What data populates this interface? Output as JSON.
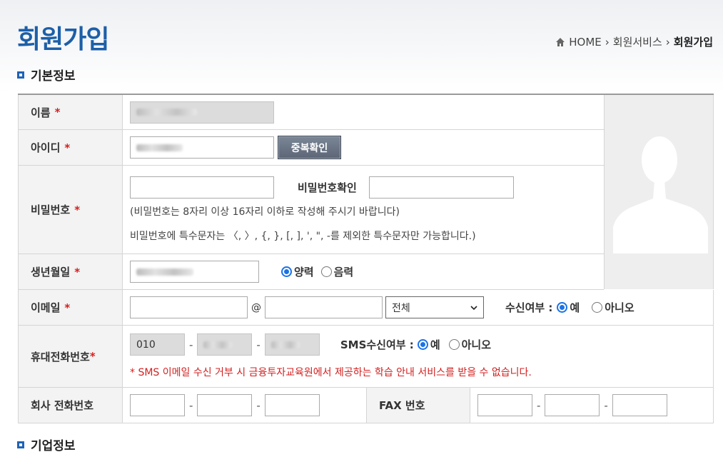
{
  "header": {
    "title": "회원가입",
    "breadcrumb": {
      "home": "HOME",
      "service": "회원서비스",
      "current": "회원가입"
    }
  },
  "sections": {
    "basic": "기본정보",
    "company": "기업정보"
  },
  "form": {
    "required_mark": "*",
    "name": {
      "label": "이름"
    },
    "userid": {
      "label": "아이디",
      "check_button": "중복확인"
    },
    "password": {
      "label": "비밀번호",
      "confirm_label": "비밀번호확인",
      "note1": "(비밀번호는 8자리 이상 16자리 이하로 작성해 주시기 바랍니다)",
      "note2": "비밀번호에 특수문자는 〈, 〉, {, }, [, ], ', \", -를 제외한 특수문자만 가능합니다.)"
    },
    "birth": {
      "label": "생년월일",
      "solar": "양력",
      "lunar": "음력",
      "selected": "양력"
    },
    "email": {
      "label": "이메일",
      "at": "@",
      "domain_select": "전체",
      "receive_label": "수신여부 :",
      "yes": "예",
      "no": "아니오",
      "selected": "예"
    },
    "mobile": {
      "label": "휴대전화번호",
      "prefix": "010",
      "dash": "-",
      "sms_label": "SMS수신여부 :",
      "yes": "예",
      "no": "아니오",
      "selected": "예",
      "warning": "* SMS 이메일 수신 거부 시 금융투자교육원에서 제공하는 학습 안내 서비스를 받을 수 없습니다."
    },
    "company_phone": {
      "label": "회사 전화번호",
      "dash": "-"
    },
    "fax": {
      "label": "FAX 번호",
      "dash": "-"
    }
  },
  "colors": {
    "title": "#1d5fa8",
    "accent_radio": "#1a73e8",
    "warning": "#d32020"
  }
}
